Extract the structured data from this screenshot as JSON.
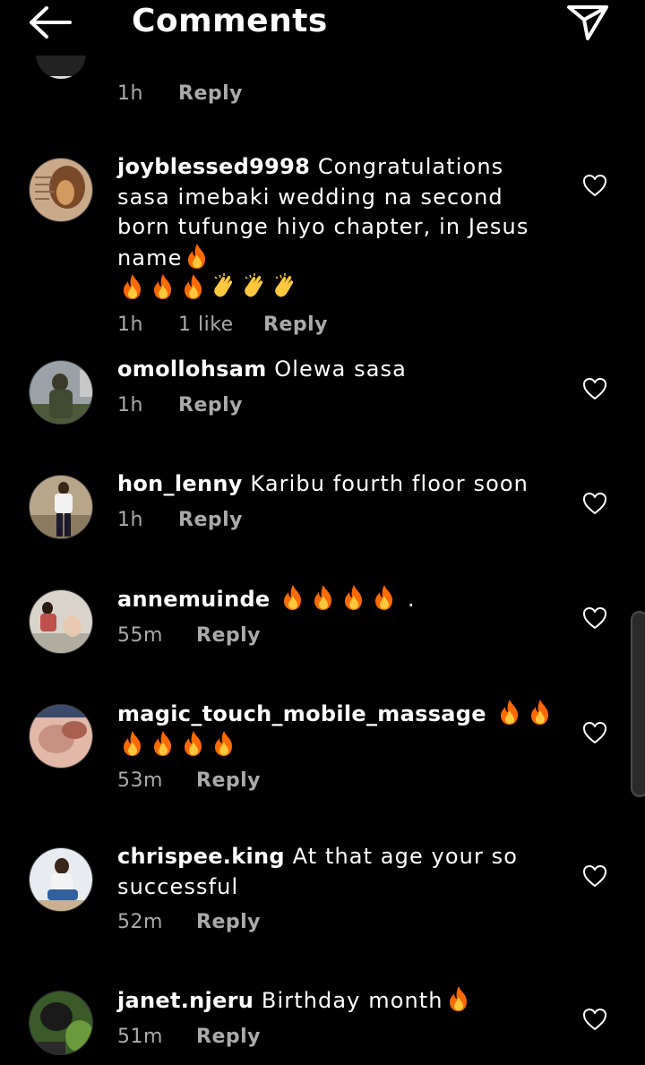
{
  "header": {
    "title": "Comments",
    "back_icon": "back-arrow-icon",
    "send_icon": "send-icon"
  },
  "previous_comment": {
    "time": "1h",
    "reply_label": "Reply"
  },
  "comments": [
    {
      "username": "joyblessed9998",
      "text": "Congratulations sasa imebaki wedding na second born tufunge hiyo chapter, in Jesus name",
      "emojis_inline": [
        "fire"
      ],
      "emojis_line2": [
        "fire",
        "fire",
        "fire",
        "clap",
        "clap",
        "clap"
      ],
      "time": "1h",
      "likes": "1 like",
      "reply_label": "Reply"
    },
    {
      "username": "omollohsam",
      "text": "Olewa sasa",
      "time": "1h",
      "reply_label": "Reply"
    },
    {
      "username": "hon_lenny",
      "text": "Karibu fourth floor soon",
      "time": "1h",
      "reply_label": "Reply"
    },
    {
      "username": "annemuinde",
      "text": ".",
      "emojis": [
        "fire",
        "fire",
        "fire",
        "fire"
      ],
      "time": "55m",
      "reply_label": "Reply"
    },
    {
      "username": "magic_touch_mobile_massage",
      "emojis": [
        "fire",
        "fire",
        "fire",
        "fire",
        "fire",
        "fire"
      ],
      "time": "53m",
      "reply_label": "Reply"
    },
    {
      "username": "chrispee.king",
      "text": "At that age your so successful",
      "time": "52m",
      "reply_label": "Reply"
    },
    {
      "username": "janet.njeru",
      "text": "Birthday month",
      "emojis": [
        "fire"
      ],
      "time": "51m",
      "reply_label": "Reply"
    }
  ],
  "colors": {
    "background": "#000000",
    "text": "#ffffff",
    "meta": "#aaaaaa",
    "fire": "#ff6a00",
    "clap": "#ffc83d"
  }
}
